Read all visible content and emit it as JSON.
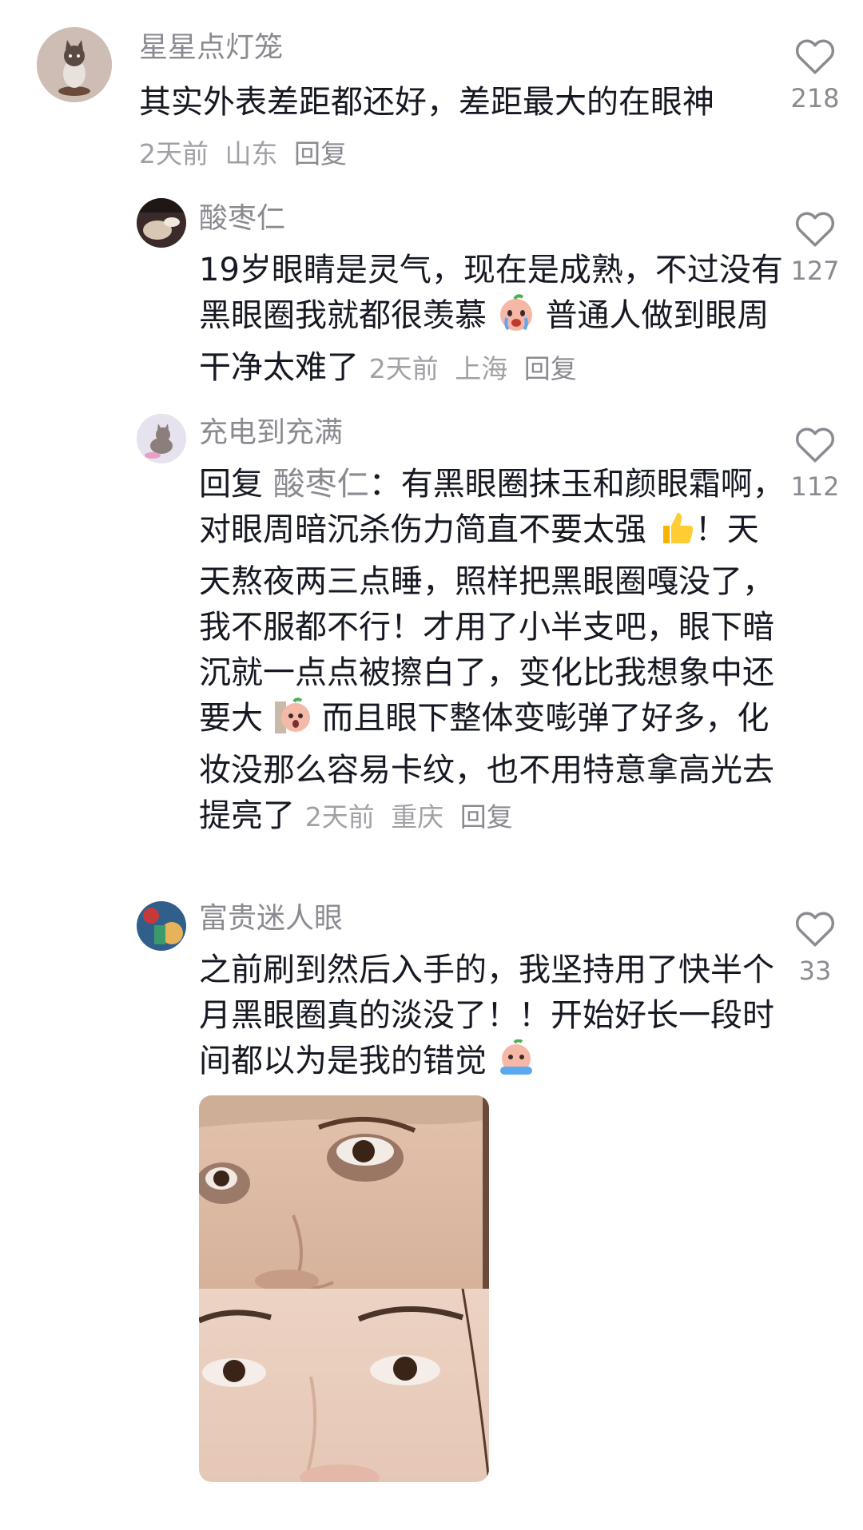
{
  "comments": [
    {
      "username": "星星点灯笼",
      "text": "其实外表差距都还好，差距最大的在眼神",
      "time": "2天前",
      "location": "山东",
      "reply_label": "回复",
      "likes": "218"
    },
    {
      "username": "酸枣仁",
      "text_a": "19岁眼睛是灵气，现在是成熟，不过没有黑眼圈我就都很羡慕",
      "text_b": "普通人做到眼周干净太难了",
      "time": "2天前",
      "location": "上海",
      "reply_label": "回复",
      "likes": "127"
    },
    {
      "username": "充电到充满",
      "reply_prefix": "回复",
      "mention": "酸枣仁",
      "text_a": "：有黑眼圈抹玉和颜眼霜啊，对眼周暗沉杀伤力简直不要太强",
      "text_b": "！天天熬夜两三点睡，照样把黑眼圈嘎没了，我不服都不行！才用了小半支吧，眼下暗沉就一点点被擦白了，变化比我想象中还要大",
      "text_c": "而且眼下整体变嘭弹了好多，化妆没那么容易卡纹，也不用特意拿高光去提亮了",
      "time": "2天前",
      "location": "重庆",
      "reply_label": "回复",
      "likes": "112"
    },
    {
      "username": "富贵迷人眼",
      "text": "之前刷到然后入手的，我坚持用了快半个月黑眼圈真的淡没了！！开始好长一段时间都以为是我的错觉",
      "likes": "33"
    }
  ],
  "icons": {
    "like": "heart-outline-icon",
    "emoji_cry": "crying-peach-emoji-icon",
    "emoji_thumbs": "thumbs-up-emoji-icon",
    "emoji_shock": "shocked-peach-emoji-icon",
    "emoji_tears": "tearful-peach-emoji-icon"
  },
  "colors": {
    "text_primary": "#161823",
    "text_secondary": "#8a8b91",
    "meta": "#a0a1a6",
    "background": "#ffffff"
  }
}
